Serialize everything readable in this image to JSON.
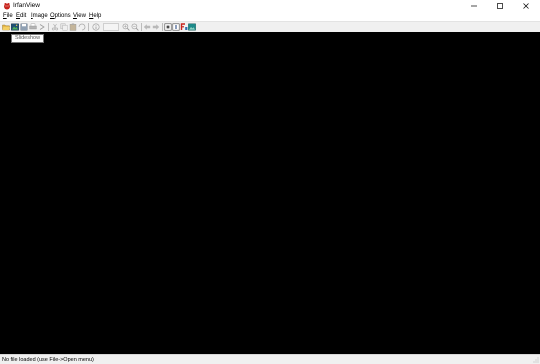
{
  "window": {
    "title": "IrfanView"
  },
  "menu": {
    "items": [
      "File",
      "Edit",
      "Image",
      "Options",
      "View",
      "Help"
    ]
  },
  "toolbar": {
    "buttons": [
      "open-folder-icon",
      "slideshow-icon",
      "save-icon",
      "print-icon",
      "rotate-icon",
      "cut-icon",
      "copy-icon",
      "paste-icon",
      "delete-icon",
      "info-icon",
      "zoom-in-icon",
      "zoom-out-icon",
      "previous-icon",
      "next-icon",
      "fit-icon",
      "help-icon",
      "settings-icon",
      "thumbnails-icon"
    ],
    "tooltip": "Slideshow"
  },
  "status": {
    "text": "No file loaded (use File->Open menu)"
  },
  "colors": {
    "viewer_background": "#000000",
    "chrome": "#f0f0f0",
    "accent_red": "#c7241d"
  }
}
